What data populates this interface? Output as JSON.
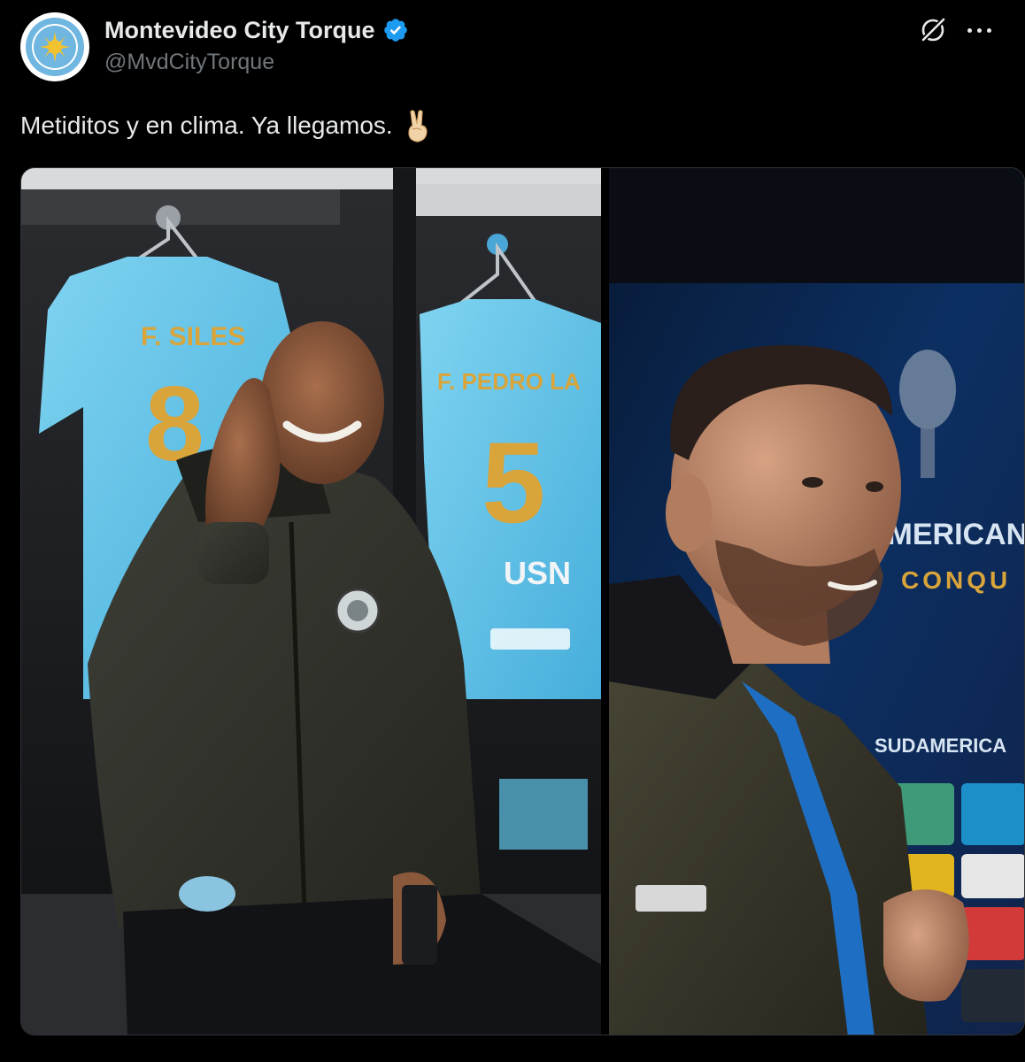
{
  "post": {
    "author": {
      "display_name": "Montevideo City Torque",
      "handle": "@MvdCityTorque",
      "verified": true,
      "avatar_icon": "club-crest-sun-icon"
    },
    "actions": {
      "grok_icon": "grok-icon",
      "more_icon": "more-options-icon"
    },
    "text": "Metiditos y en clima. Ya llegamos.",
    "emoji": "victory-hand-emoji",
    "media": [
      {
        "kind": "photo",
        "description_icon": "locker-room-photo",
        "jersey_left_name": "F. SILES",
        "jersey_left_number": "8",
        "jersey_right_name": "F. PEDRO LA",
        "jersey_right_number": "5",
        "sponsor": "USN"
      },
      {
        "kind": "photo",
        "description_icon": "press-backdrop-photo",
        "backdrop_lines": [
          "AMERICANA",
          "CONQU",
          "SUDAMERICA"
        ]
      }
    ]
  },
  "colors": {
    "background": "#000000",
    "text_primary": "#e7e9ea",
    "text_secondary": "#71767b",
    "verified_blue": "#1d9bf0",
    "jersey_blue": "#5fc4e8",
    "jersey_gold": "#d9a43a"
  }
}
